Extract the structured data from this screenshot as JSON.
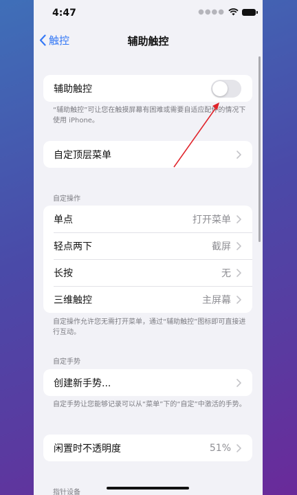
{
  "status_bar": {
    "time": "4:47"
  },
  "nav": {
    "back_label": "触控",
    "title": "辅助触控"
  },
  "toggle_section": {
    "label": "辅助触控",
    "enabled": false,
    "footer": "“辅助触控”可让您在触摸屏幕有困难或需要自适应配件的情况下使用 iPhone。"
  },
  "top_menu": {
    "label": "自定顶层菜单"
  },
  "custom_actions": {
    "header": "自定操作",
    "items": [
      {
        "label": "单点",
        "value": "打开菜单"
      },
      {
        "label": "轻点两下",
        "value": "截屏"
      },
      {
        "label": "长按",
        "value": "无"
      },
      {
        "label": "三维触控",
        "value": "主屏幕"
      }
    ],
    "footer": "自定操作允许您无需打开菜单，通过“辅助触控”图标即可直接进行互动。"
  },
  "custom_gestures": {
    "header": "自定手势",
    "create_label": "创建新手势...",
    "footer": "自定手势让您能够记录可以从“菜单”下的“自定”中激活的手势。"
  },
  "idle_opacity": {
    "label": "闲置时不透明度",
    "value": "51%"
  },
  "pointer_devices": {
    "header": "指针设备"
  },
  "colors": {
    "accent": "#3478f6",
    "annotation": "#e0242b"
  }
}
